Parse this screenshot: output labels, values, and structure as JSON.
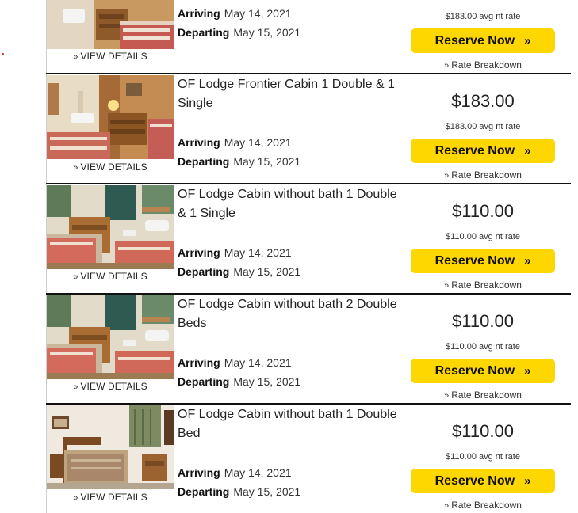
{
  "labels": {
    "view_details": "VIEW DETAILS",
    "arriving": "Arriving",
    "departing": "Departing",
    "reserve": "Reserve Now",
    "rate_breakdown": "Rate Breakdown",
    "chevron": "»"
  },
  "rooms": [
    {
      "title": "",
      "price": "",
      "avg_rate": "$183.00 avg nt rate",
      "arrive": "May 14, 2021",
      "depart": "May 15, 2021",
      "image": "lodge-room-photo"
    },
    {
      "title": "OF Lodge Frontier Cabin 1 Double & 1 Single",
      "price": "$183.00",
      "avg_rate": "$183.00 avg nt rate",
      "arrive": "May 14, 2021",
      "depart": "May 15, 2021",
      "image": "frontier-cabin-photo"
    },
    {
      "title": "OF Lodge Cabin without bath 1 Double & 1 Single",
      "price": "$110.00",
      "avg_rate": "$110.00 avg nt rate",
      "arrive": "May 14, 2021",
      "depart": "May 15, 2021",
      "image": "cabin-no-bath-photo"
    },
    {
      "title": "OF Lodge Cabin without bath 2 Double Beds",
      "price": "$110.00",
      "avg_rate": "$110.00 avg nt rate",
      "arrive": "May 14, 2021",
      "depart": "May 15, 2021",
      "image": "cabin-no-bath-photo"
    },
    {
      "title": "OF Lodge Cabin without bath 1 Double Bed",
      "price": "$110.00",
      "avg_rate": "$110.00 avg nt rate",
      "arrive": "May 14, 2021",
      "depart": "May 15, 2021",
      "image": "cabin-double-bed-photo"
    }
  ],
  "colors": {
    "accent": "#ffd700",
    "divider": "#111111"
  }
}
